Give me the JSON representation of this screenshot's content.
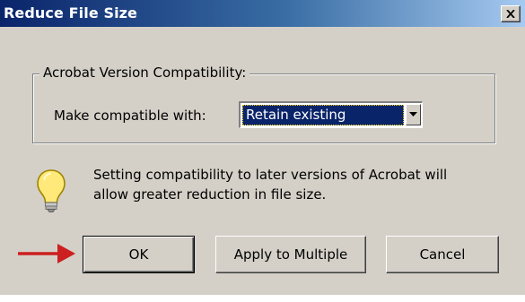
{
  "window": {
    "title": "Reduce File Size",
    "close_icon": "close-x-icon"
  },
  "compatibility": {
    "group_title": "Acrobat Version Compatibility:",
    "label": "Make compatible with:",
    "selected_value": "Retain existing"
  },
  "info": {
    "icon": "lightbulb-icon",
    "line1": "Setting compatibility to later versions of Acrobat will",
    "line2": "allow greater reduction in file size."
  },
  "buttons": {
    "ok_label": "OK",
    "apply_label": "Apply to Multiple",
    "cancel_label": "Cancel"
  },
  "annotation": {
    "icon": "red-arrow-icon",
    "color": "#cc1f1f"
  },
  "colors": {
    "titlebar_start": "#0a246a",
    "dialog_bg": "#d4d0c8",
    "selection_bg": "#0a246a"
  }
}
